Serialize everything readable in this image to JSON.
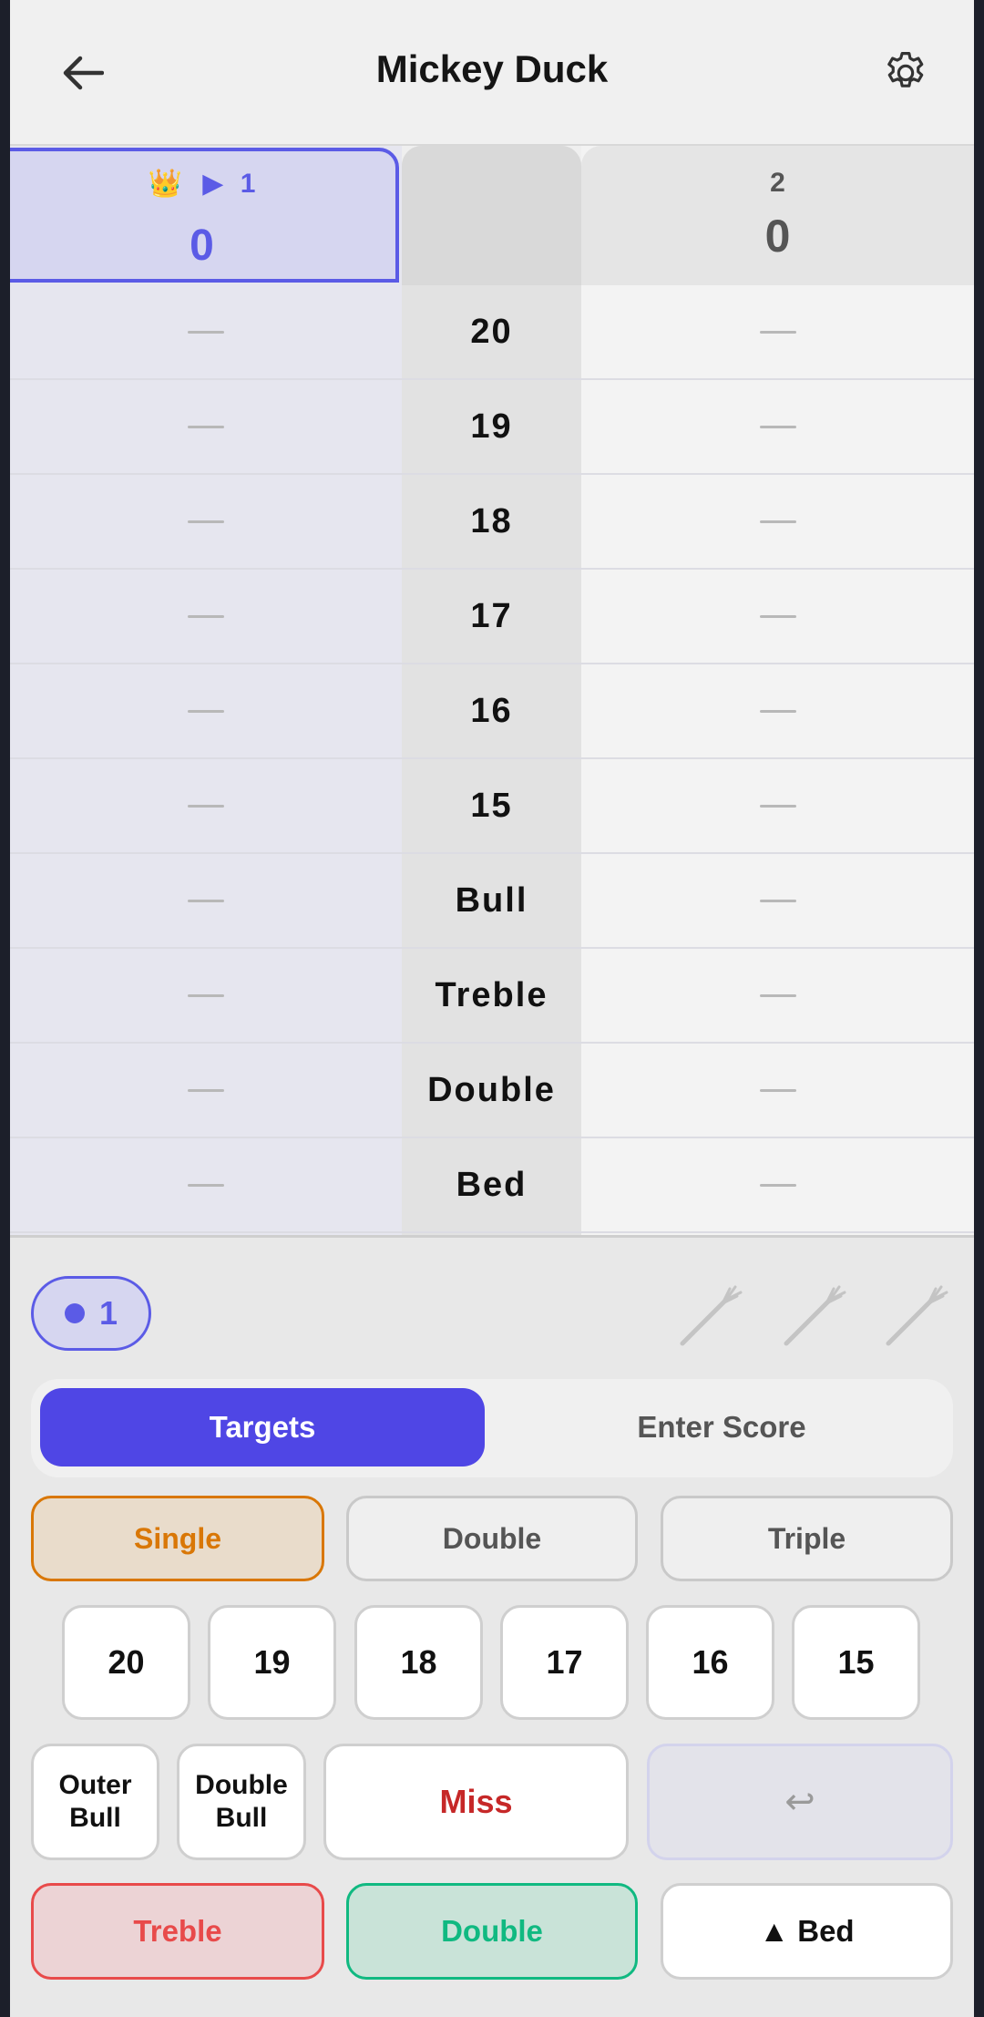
{
  "header": {
    "title": "Mickey Duck"
  },
  "players": [
    {
      "crown": "👑",
      "turn_marker": "▶",
      "number": "1",
      "score": "0"
    },
    {
      "number": "2",
      "score": "0"
    }
  ],
  "targets": [
    "20",
    "19",
    "18",
    "17",
    "16",
    "15",
    "Bull",
    "Treble",
    "Double",
    "Bed"
  ],
  "dart": {
    "count": "1",
    "remaining_darts": 3
  },
  "tabs": {
    "targets": "Targets",
    "enter_score": "Enter Score"
  },
  "multipliers": {
    "single": "Single",
    "double": "Double",
    "triple": "Triple"
  },
  "numbers": [
    "20",
    "19",
    "18",
    "17",
    "16",
    "15"
  ],
  "specials": {
    "outer_bull_line1": "Outer",
    "outer_bull_line2": "Bull",
    "double_bull_line1": "Double",
    "double_bull_line2": "Bull",
    "miss": "Miss",
    "undo": "↩"
  },
  "bottom": {
    "treble": "Treble",
    "double": "Double",
    "bed": "▲ Bed"
  },
  "colors": {
    "accent": "#4f46e5",
    "single": "#d97706",
    "miss": "#c62828",
    "treble": "#e84a4a",
    "double": "#10b981"
  }
}
